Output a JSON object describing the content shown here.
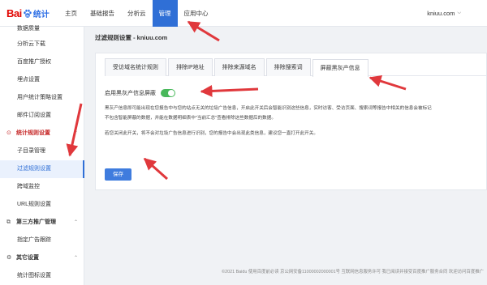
{
  "header": {
    "logo_text_bai": "Bai",
    "logo_text_tj": "统计",
    "nav": [
      "主页",
      "基础报告",
      "分析云",
      "管理",
      "应用中心"
    ],
    "active_nav": 3,
    "user": "kniuu.com",
    "user_caret": "⌵"
  },
  "sidebar": {
    "items": [
      {
        "label": "数据质量"
      },
      {
        "label": "分析云下载"
      },
      {
        "label": "百度推广授权"
      },
      {
        "label": "埋点设置"
      },
      {
        "label": "用户统计策略设置"
      },
      {
        "label": "邮件订阅设置"
      },
      {
        "label": "统计规则设置",
        "group": true,
        "icon": "⊙",
        "chev": "⌃"
      },
      {
        "label": "子目录管理"
      },
      {
        "label": "过滤规则设置"
      },
      {
        "label": "跨域监控"
      },
      {
        "label": "URL规则设置"
      },
      {
        "label": "第三方推广管理",
        "group": true,
        "icon": "⧉",
        "chev": "⌃"
      },
      {
        "label": "指定广告跟踪"
      },
      {
        "label": "其它设置",
        "group": true,
        "icon": "⚙",
        "chev": "⌃"
      },
      {
        "label": "统计图标设置"
      }
    ]
  },
  "main": {
    "breadcrumb": "过滤规则设置 - kniuu.com",
    "tabs": [
      "受访域名统计规则",
      "排除IP地址",
      "排除来源域名",
      "排除搜索词",
      "屏蔽黑灰产信息"
    ],
    "active_tab": 4,
    "toggle_label": "启用黑灰产信息屏蔽",
    "toggle_on": true,
    "desc_line1": "黑灰产信息即可能出现在您报告中与您的站点无关的垃圾广告信息，开启此开关后会智能识别这些信息，实时访客、受访页面、搜索词等报告中相关的信息会被标记",
    "desc_line2": "不包含智能屏蔽的数据，并能在数据明细表中\"当前汇总\"查看排除这些数据后的数据。",
    "desc_line3": "若您关闭此开关，将不会对垃圾广告信息进行识别，您的报告中会出现此类信息，建议您一直打开此开关。",
    "save_label": "保存"
  },
  "footer": {
    "text": "©2021 Baidu 使用百度前必读 京公网安备11000002000001号 互联网信息服务许可 我已阅读并接受百度推广服务合同 欢迎访问百度推广"
  },
  "colors": {
    "accent": "#2f6fd6",
    "toggle_on": "#48b85a",
    "arrow": "#e0383c",
    "group_open": "#c62828"
  }
}
